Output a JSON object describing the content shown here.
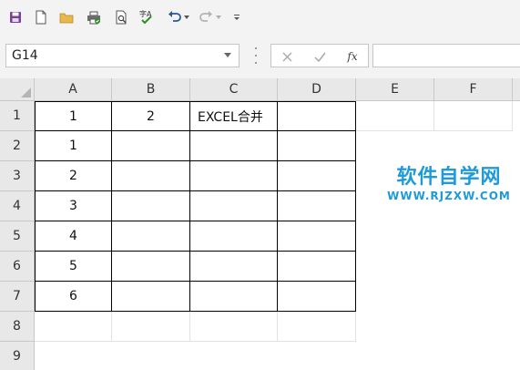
{
  "toolbar": {
    "icons": [
      "save-icon",
      "new-document-icon",
      "open-folder-icon",
      "print-icon",
      "print-preview-icon",
      "spelling-icon",
      "undo-icon",
      "dropdown-caret-icon",
      "redo-icon",
      "dropdown-caret-icon",
      "customize-toolbar-icon"
    ]
  },
  "formula_bar": {
    "name_box": "G14",
    "cancel_symbol": "✕",
    "enter_symbol": "✓",
    "function_symbol": "fx",
    "formula": ""
  },
  "columns": [
    "A",
    "B",
    "C",
    "D",
    "E",
    "F"
  ],
  "rows": [
    "1",
    "2",
    "3",
    "4",
    "5",
    "6",
    "7",
    "8",
    "9"
  ],
  "cells": {
    "A1": "1",
    "B1": "2",
    "C1": "EXCEL合并",
    "A2": "1",
    "A3": "2",
    "A4": "3",
    "A5": "4",
    "A6": "5",
    "A7": "6"
  },
  "watermark": {
    "title": "软件自学网",
    "url": "WWW.RJZXW.COM",
    "color": "#1e9ad9"
  },
  "colors": {
    "toolbar_bg": "#f3f3f3",
    "header_bg": "#e8e8e8",
    "save_icon": "#7a3f9e",
    "folder_icon": "#e8b84a",
    "check_icon": "#2e8b2e",
    "undo_icon": "#2b579a"
  }
}
